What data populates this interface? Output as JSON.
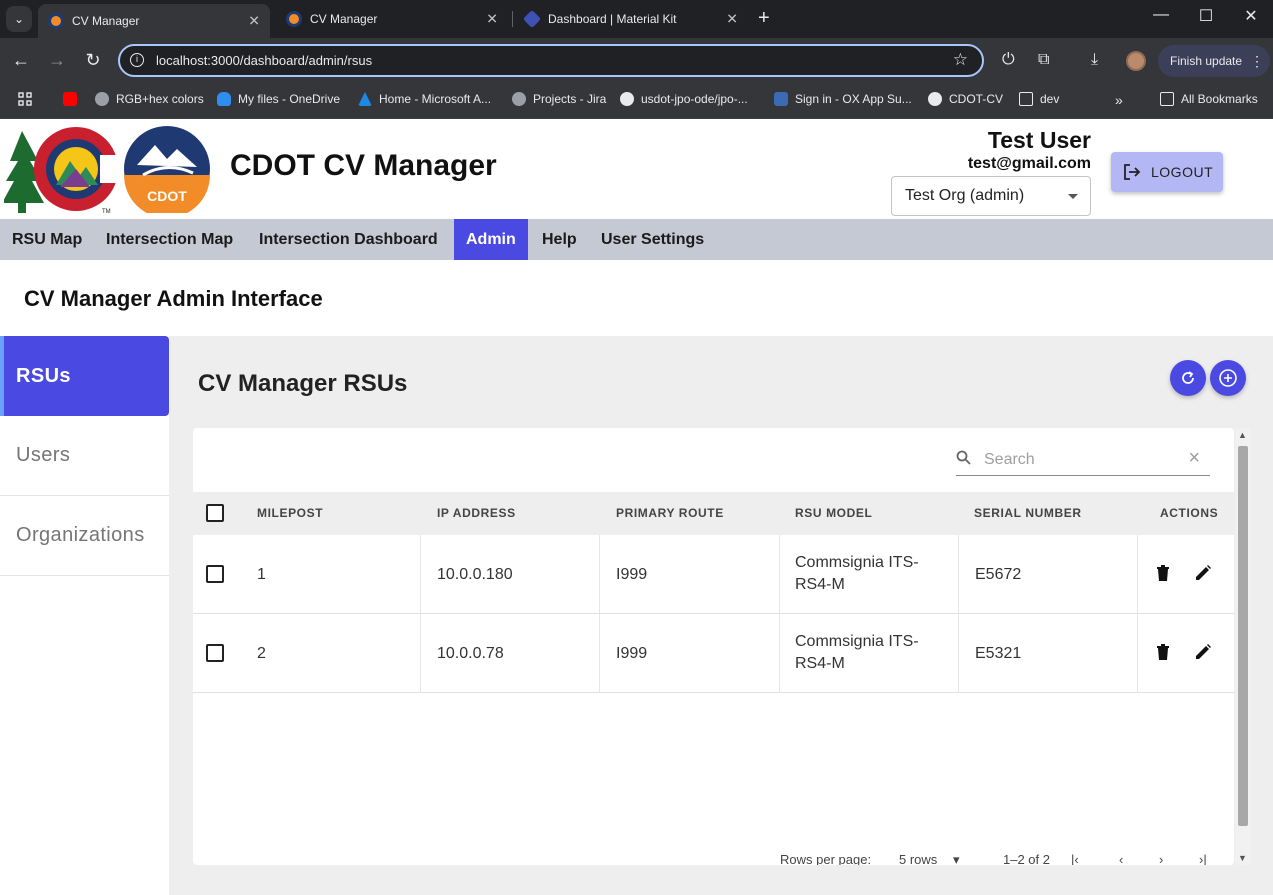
{
  "browser": {
    "tabs": [
      {
        "title": "CV Manager",
        "active": true
      },
      {
        "title": "CV Manager",
        "active": false
      },
      {
        "title": "Dashboard | Material Kit",
        "active": false
      }
    ],
    "url": "localhost:3000/dashboard/admin/rsus",
    "finish_update": "Finish update",
    "bookmarks": [
      "RGB+hex colors",
      "My files - OneDrive",
      "Home - Microsoft A...",
      "Projects - Jira",
      "usdot-jpo-ode/jpo-...",
      "Sign in - OX App Su...",
      "CDOT-CV",
      "dev"
    ],
    "all_bookmarks": "All Bookmarks"
  },
  "header": {
    "title": "CDOT CV Manager",
    "cdot_logo_text": "CDOT",
    "user_name": "Test User",
    "user_email": "test@gmail.com",
    "org_selected": "Test Org (admin)",
    "logout_label": "LOGOUT"
  },
  "nav": {
    "items": [
      "RSU Map",
      "Intersection Map",
      "Intersection Dashboard",
      "Admin",
      "Help",
      "User Settings"
    ],
    "active": "Admin"
  },
  "admin": {
    "title": "CV Manager Admin Interface",
    "sidebar": [
      "RSUs",
      "Users",
      "Organizations"
    ],
    "sidebar_active": "RSUs"
  },
  "rsus": {
    "title": "CV Manager RSUs",
    "search_placeholder": "Search",
    "columns": [
      "MILEPOST",
      "IP ADDRESS",
      "PRIMARY ROUTE",
      "RSU MODEL",
      "SERIAL NUMBER",
      "ACTIONS"
    ],
    "rows": [
      {
        "milepost": "1",
        "ip": "10.0.0.180",
        "route": "I999",
        "model_line1": "Commsignia ITS-",
        "model_line2": "RS4-M",
        "serial": "E5672"
      },
      {
        "milepost": "2",
        "ip": "10.0.0.78",
        "route": "I999",
        "model_line1": "Commsignia ITS-",
        "model_line2": "RS4-M",
        "serial": "E5321"
      }
    ],
    "footer": {
      "rows_per_page_label": "Rows per page:",
      "rows_per_page_value": "5 rows",
      "range": "1–2 of 2"
    }
  },
  "colors": {
    "accent": "#4a49e2",
    "nav_bg": "#c5c9d3",
    "logout_bg": "#b3b7f3"
  }
}
